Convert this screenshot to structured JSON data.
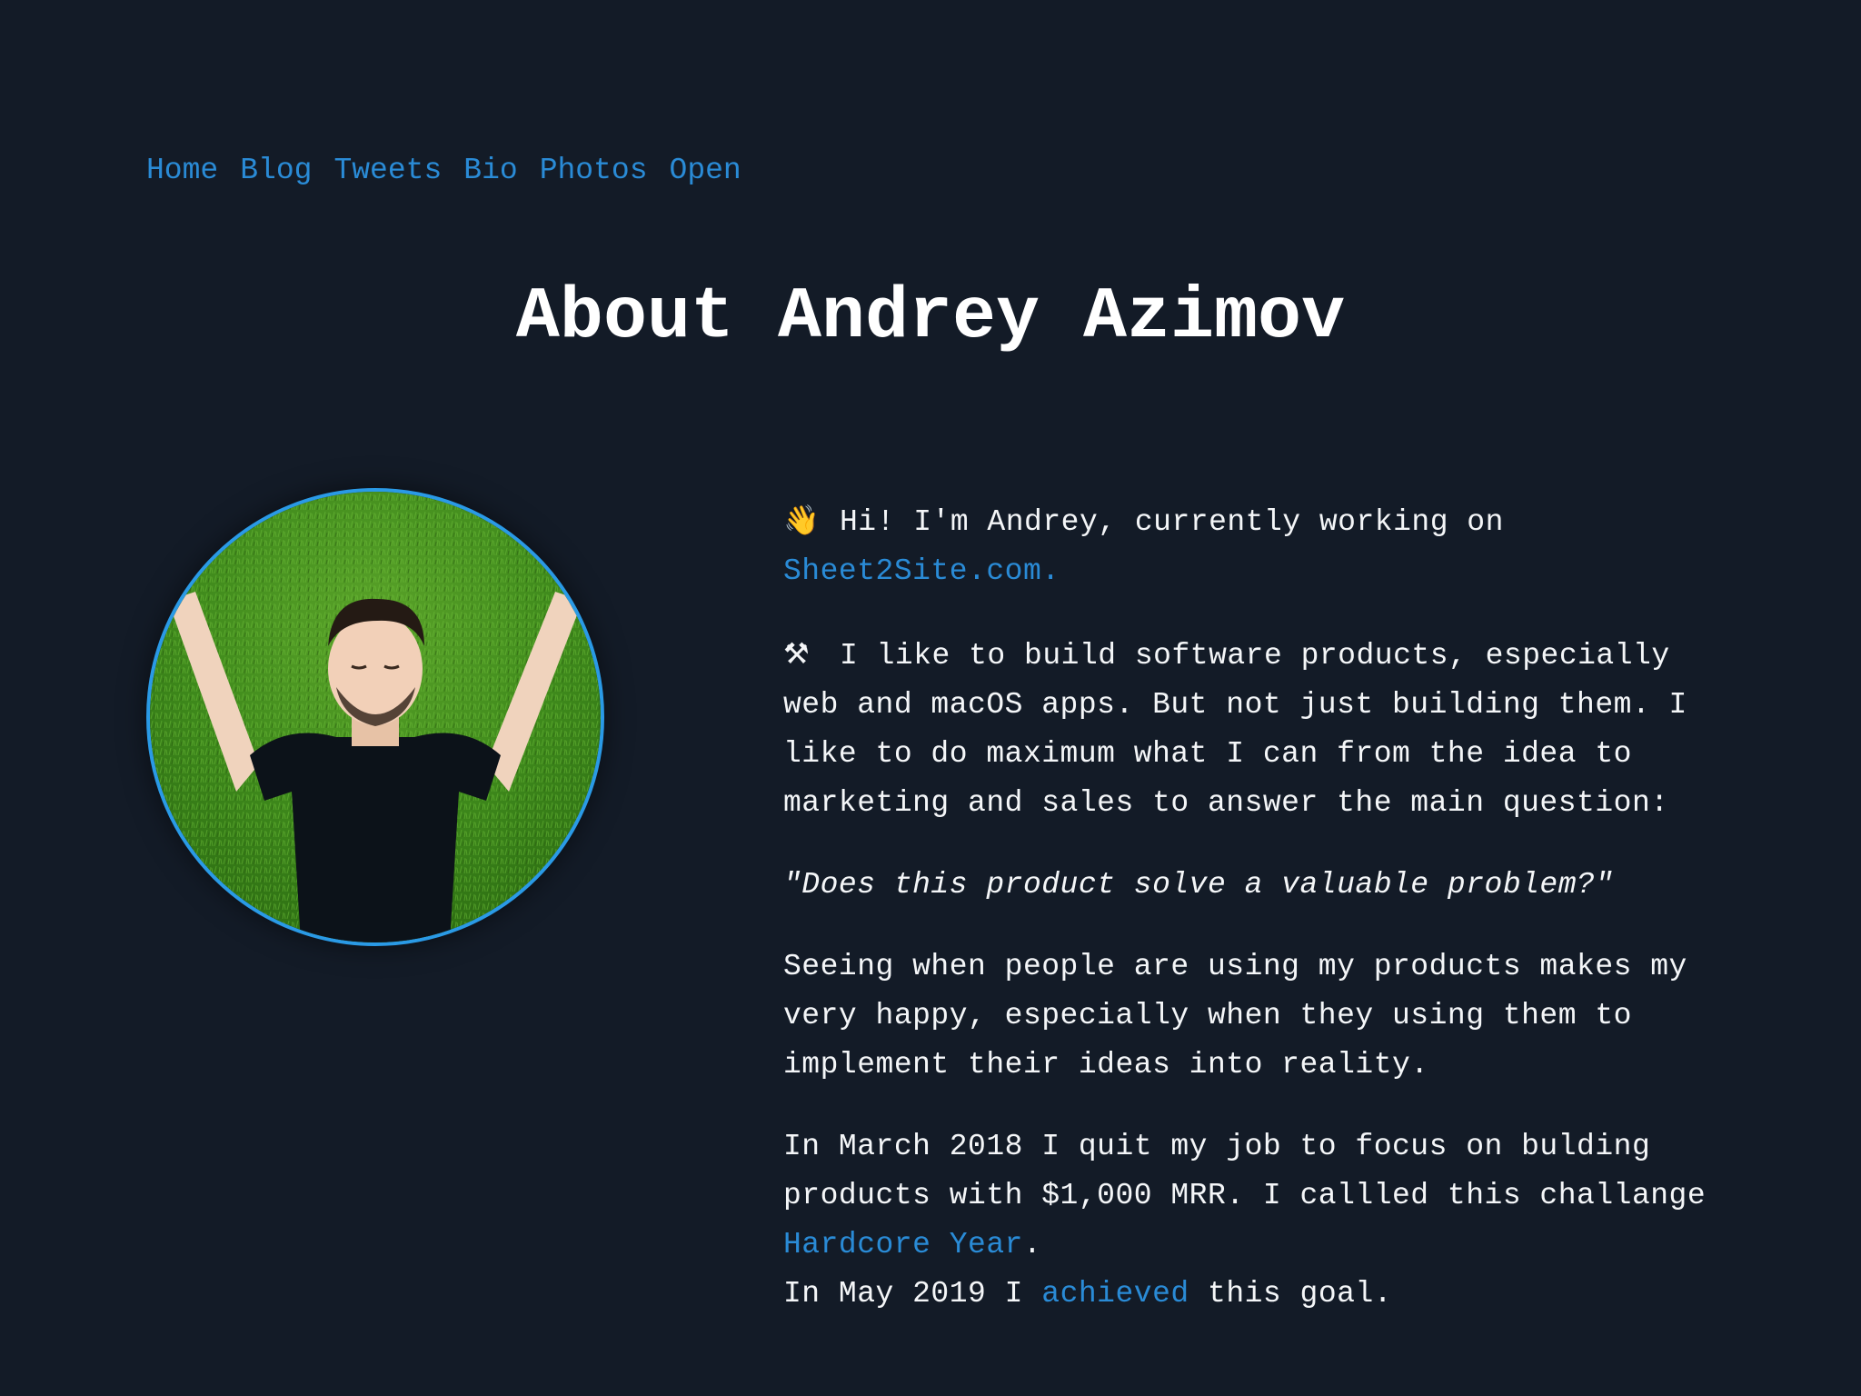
{
  "nav": {
    "items": [
      "Home",
      "Blog",
      "Tweets",
      "Bio",
      "Photos",
      "Open"
    ]
  },
  "page": {
    "title": "About Andrey Azimov"
  },
  "colors": {
    "background": "#131b27",
    "link": "#2a8bd6",
    "avatar_border": "#2a9ae6",
    "text": "#ffffff"
  },
  "content": {
    "intro_icon": "waving-hand-icon",
    "intro_text": "Hi! I'm Andrey, currently working on",
    "intro_link": "Sheet2Site.com.",
    "build_icon": "hammer-and-wrench-icon",
    "build_text": "I like to build software products, especially web and macOS apps. But not just building them. I like to do maximum what I can from the idea to marketing and sales to answer the main question:",
    "quote": "\"Does this product solve a valuable problem?\"",
    "happy_text": "Seeing when people are using my products makes my very happy, especially when they using them to implement their ideas into reality.",
    "march_text_1": "In March 2018 I quit my job to focus on bulding products with $1,000 MRR. I callled this challange",
    "march_link": "Hardcore Year",
    "march_text_2": ".",
    "may_text_1": "In May 2019 I",
    "may_link": "achieved",
    "may_text_2": "this goal."
  }
}
